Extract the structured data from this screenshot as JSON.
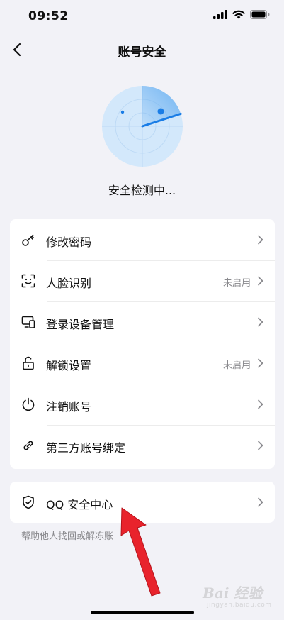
{
  "status_bar": {
    "time": "09:52"
  },
  "nav": {
    "title": "账号安全"
  },
  "detect": {
    "text": "安全检测中..."
  },
  "menu_items": [
    {
      "label": "修改密码",
      "status": "",
      "icon": "key-icon"
    },
    {
      "label": "人脸识别",
      "status": "未启用",
      "icon": "face-scan-icon"
    },
    {
      "label": "登录设备管理",
      "status": "",
      "icon": "devices-icon"
    },
    {
      "label": "解锁设置",
      "status": "未启用",
      "icon": "unlock-icon"
    },
    {
      "label": "注销账号",
      "status": "",
      "icon": "power-icon"
    },
    {
      "label": "第三方账号绑定",
      "status": "",
      "icon": "link-icon"
    }
  ],
  "qq_security": {
    "label": "QQ 安全中心",
    "icon": "shield-check-icon"
  },
  "help": {
    "text": "帮助他人找回或解冻账"
  },
  "watermark": {
    "brand": "Bai 经验",
    "url": "jingyan.baidu.com"
  },
  "colors": {
    "accent": "#1a7de6",
    "radar_fill": "#d3e8fb",
    "arrow": "#e8232c",
    "background": "#f2f2f7"
  }
}
